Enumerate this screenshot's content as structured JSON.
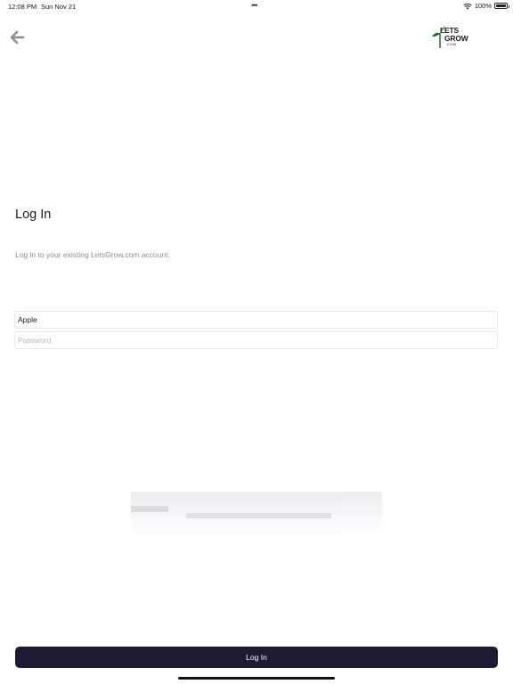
{
  "status_bar": {
    "time": "12:08 PM",
    "date": "Sun Nov 21",
    "dots": "•••",
    "battery": "100%"
  },
  "header": {
    "back_icon": "arrow-left-icon",
    "logo": {
      "line1": "LETS",
      "line2": "GROW",
      "line3": ".COM"
    }
  },
  "main": {
    "title": "Log In",
    "subtitle": "Log in to your existing LetsGrow.com account.",
    "username": {
      "value": "Apple",
      "placeholder": ""
    },
    "password": {
      "value": "",
      "placeholder": "Password"
    }
  },
  "footer": {
    "login_label": "Log In"
  },
  "colors": {
    "button_bg": "#1d1a33",
    "button_text": "#ffffff",
    "subtitle": "#8e8e93",
    "field_border": "#e8e8ec"
  }
}
